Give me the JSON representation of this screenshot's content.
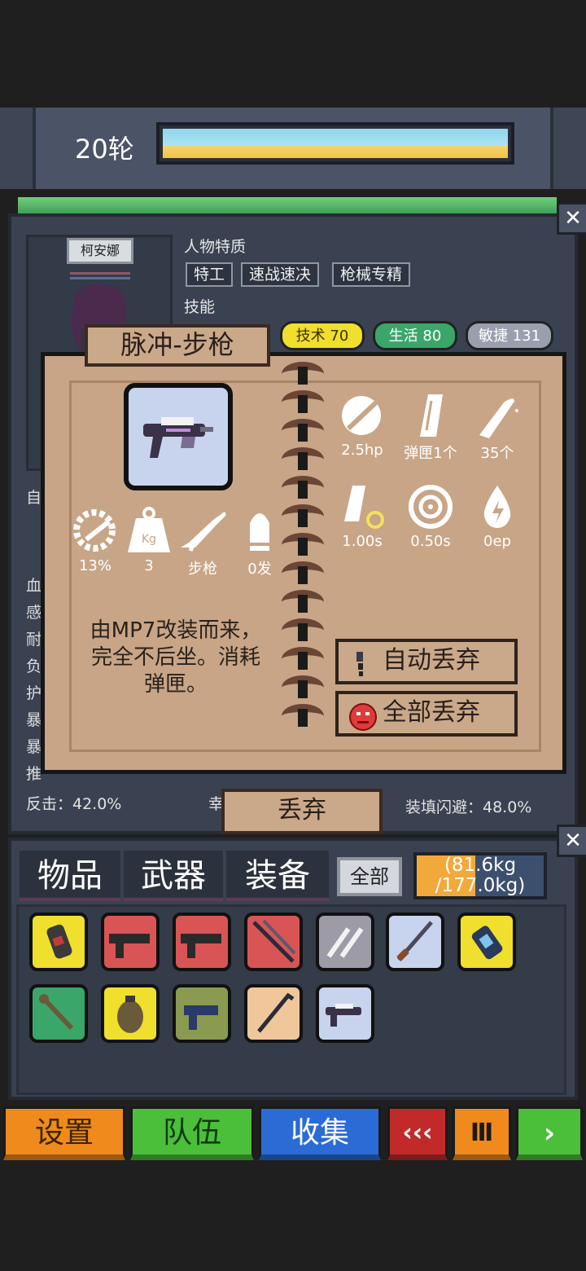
{
  "top": {
    "round": "20轮"
  },
  "character": {
    "name": "柯安娜",
    "traits_title": "人物特质",
    "traits": [
      "特工",
      "速战速决",
      "枪械专精"
    ],
    "skills_title": "技能",
    "skills": [
      "技术 70",
      "生活 80",
      "敏捷 131"
    ],
    "side_letters": [
      "血",
      "感",
      "耐",
      "负",
      "护",
      "暴",
      "暴",
      "推"
    ],
    "section_initial": "自",
    "stats": {
      "counter": "反击：42.0%",
      "reload_dodge": "装填闪避：48.0%",
      "partial": "幸"
    },
    "discard_label": "丢弃"
  },
  "weapon": {
    "title": "脉冲-步枪",
    "description_lines": [
      "由MP7改装而来，",
      "完全不后坐。消耗",
      "弹匣。"
    ],
    "stats_left": [
      {
        "icon": "recoil-gear-icon",
        "value": "13%"
      },
      {
        "icon": "weight-icon",
        "value": "3"
      },
      {
        "icon": "rifle-icon",
        "value": "步枪"
      },
      {
        "icon": "ammo-icon",
        "value": "0发"
      }
    ],
    "stats_right": [
      {
        "icon": "damage-icon",
        "value": "2.5hp"
      },
      {
        "icon": "magazine-icon",
        "value": "弹匣1个"
      },
      {
        "icon": "bullet-icon",
        "value": "35个"
      },
      {
        "icon": "reload-icon",
        "value": "1.00s"
      },
      {
        "icon": "crosshair-icon",
        "value": "0.50s"
      },
      {
        "icon": "energy-icon",
        "value": "0ep"
      }
    ],
    "auto_discard": "自动丢弃",
    "discard_all": "全部丢弃",
    "weight_icon_text": "Kg"
  },
  "inventory": {
    "tabs": [
      "物品",
      "武器",
      "装备"
    ],
    "all_label": "全部",
    "weight_line1": "(81.6kg",
    "weight_line2": "/177.0kg)",
    "weight_fraction": 0.461
  },
  "nav": {
    "settings": "设置",
    "team": "队伍",
    "collect": "收集",
    "rewind": "‹‹‹",
    "pause": "Ⅲ",
    "play": "›"
  },
  "colors": {
    "panel": "#3a4252",
    "paper": "#c7a586",
    "accent_orange": "#f2a93b",
    "skill_yellow": "#f0df2c",
    "skill_green": "#3ba66a"
  }
}
